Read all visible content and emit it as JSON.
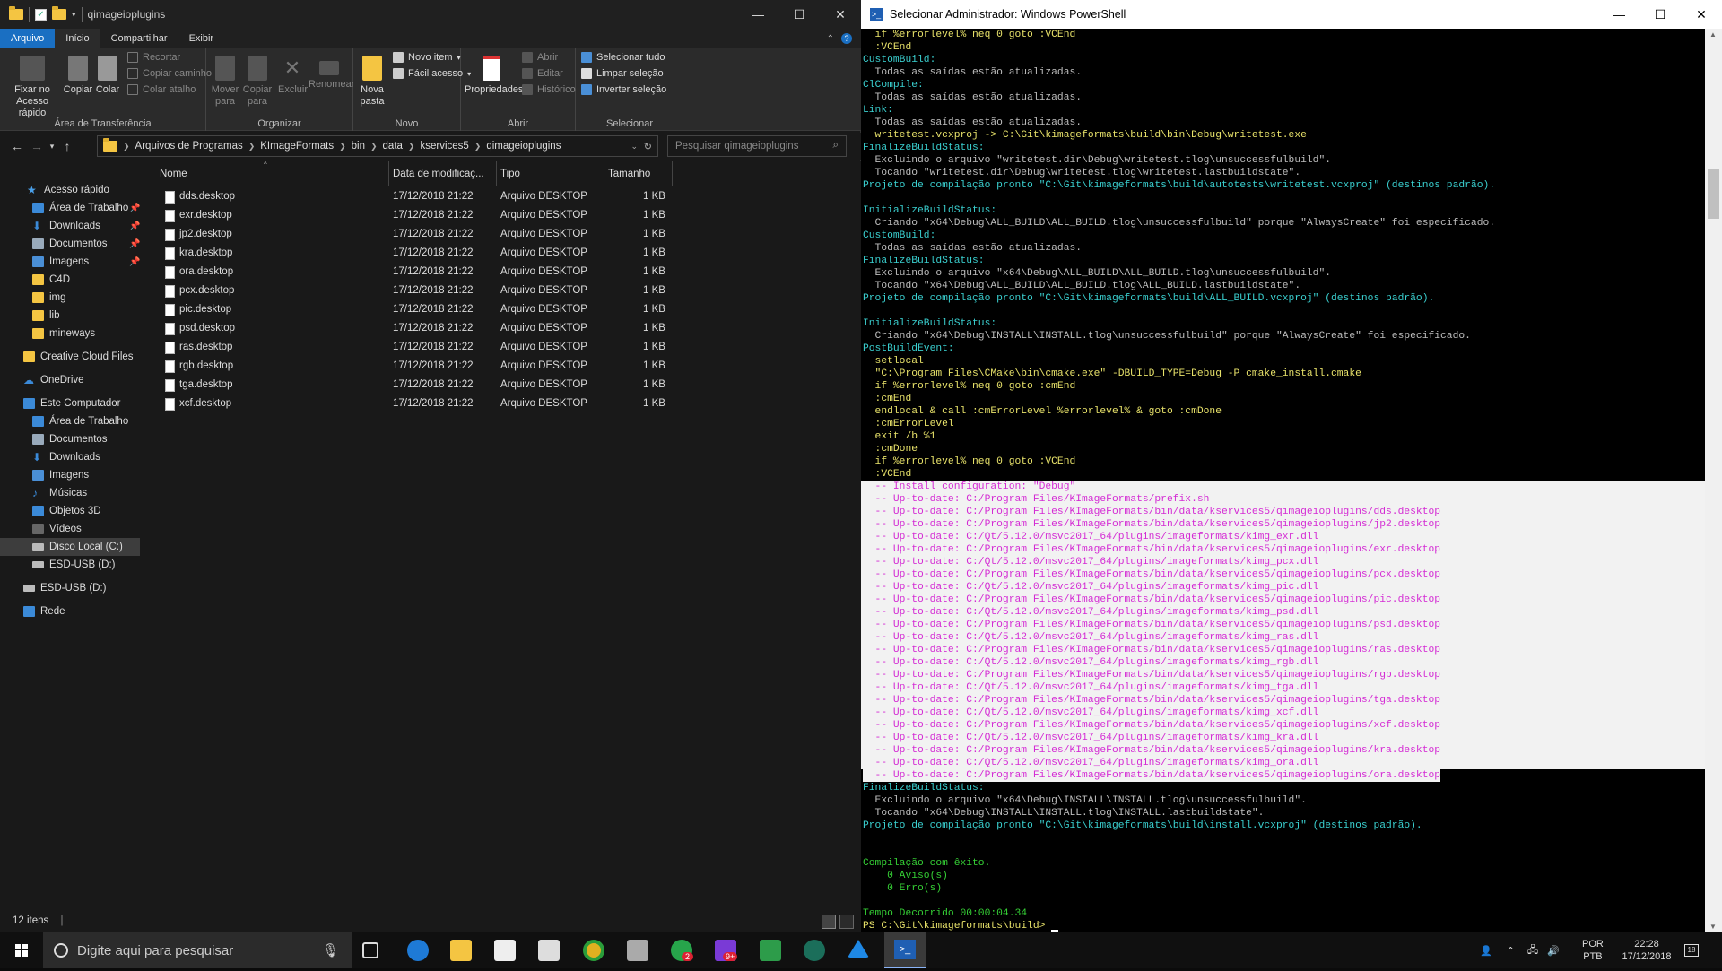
{
  "explorer": {
    "title": "qimageioplugins",
    "tabs": [
      "Arquivo",
      "Início",
      "Compartilhar",
      "Exibir"
    ],
    "ribbon": {
      "pin": "Fixar no Acesso rápido",
      "copy": "Copiar",
      "paste": "Colar",
      "cut": "Recortar",
      "copy_path": "Copiar caminho",
      "paste_shortcut": "Colar atalho",
      "group_clipboard": "Área de Transferência",
      "move_to": "Mover para",
      "copy_to": "Copiar para",
      "delete": "Excluir",
      "rename": "Renomear",
      "group_organize": "Organizar",
      "new_folder": "Nova pasta",
      "new_item": "Novo item",
      "easy_access": "Fácil acesso",
      "group_new": "Novo",
      "properties": "Propriedades",
      "open": "Abrir",
      "edit": "Editar",
      "history": "Histórico",
      "group_open": "Abrir",
      "select_all": "Selecionar tudo",
      "select_none": "Limpar seleção",
      "invert": "Inverter seleção",
      "group_select": "Selecionar"
    },
    "breadcrumb": [
      "Arquivos de Programas",
      "KImageFormats",
      "bin",
      "data",
      "kservices5",
      "qimageioplugins"
    ],
    "search_placeholder": "Pesquisar qimageioplugins",
    "nav": {
      "quick_access": "Acesso rápido",
      "desktop_pin": "Área de Trabalho",
      "downloads_pin": "Downloads",
      "documents_pin": "Documentos",
      "images_pin": "Imagens",
      "c4d": "C4D",
      "img": "img",
      "lib": "lib",
      "mineways": "mineways",
      "creative_cloud": "Creative Cloud Files",
      "onedrive": "OneDrive",
      "this_pc": "Este Computador",
      "pc_desktop": "Área de Trabalho",
      "pc_documents": "Documentos",
      "pc_downloads": "Downloads",
      "pc_images": "Imagens",
      "pc_music": "Músicas",
      "pc_3d": "Objetos 3D",
      "pc_videos": "Vídeos",
      "local_disk": "Disco Local (C:)",
      "esd_usb": "ESD-USB (D:)",
      "esd_usb2": "ESD-USB (D:)",
      "network": "Rede"
    },
    "columns": {
      "name": "Nome",
      "date": "Data de modificaç...",
      "type": "Tipo",
      "size": "Tamanho"
    },
    "files": [
      {
        "name": "dds.desktop",
        "date": "17/12/2018 21:22",
        "type": "Arquivo DESKTOP",
        "size": "1 KB"
      },
      {
        "name": "exr.desktop",
        "date": "17/12/2018 21:22",
        "type": "Arquivo DESKTOP",
        "size": "1 KB"
      },
      {
        "name": "jp2.desktop",
        "date": "17/12/2018 21:22",
        "type": "Arquivo DESKTOP",
        "size": "1 KB"
      },
      {
        "name": "kra.desktop",
        "date": "17/12/2018 21:22",
        "type": "Arquivo DESKTOP",
        "size": "1 KB"
      },
      {
        "name": "ora.desktop",
        "date": "17/12/2018 21:22",
        "type": "Arquivo DESKTOP",
        "size": "1 KB"
      },
      {
        "name": "pcx.desktop",
        "date": "17/12/2018 21:22",
        "type": "Arquivo DESKTOP",
        "size": "1 KB"
      },
      {
        "name": "pic.desktop",
        "date": "17/12/2018 21:22",
        "type": "Arquivo DESKTOP",
        "size": "1 KB"
      },
      {
        "name": "psd.desktop",
        "date": "17/12/2018 21:22",
        "type": "Arquivo DESKTOP",
        "size": "1 KB"
      },
      {
        "name": "ras.desktop",
        "date": "17/12/2018 21:22",
        "type": "Arquivo DESKTOP",
        "size": "1 KB"
      },
      {
        "name": "rgb.desktop",
        "date": "17/12/2018 21:22",
        "type": "Arquivo DESKTOP",
        "size": "1 KB"
      },
      {
        "name": "tga.desktop",
        "date": "17/12/2018 21:22",
        "type": "Arquivo DESKTOP",
        "size": "1 KB"
      },
      {
        "name": "xcf.desktop",
        "date": "17/12/2018 21:22",
        "type": "Arquivo DESKTOP",
        "size": "1 KB"
      }
    ],
    "status": "12 itens"
  },
  "powershell": {
    "title": "Selecionar Administrador: Windows PowerShell",
    "lines": [
      {
        "t": "  if %errorlevel% neq 0 goto :VCEnd",
        "c": "y"
      },
      {
        "t": "  :VCEnd",
        "c": "y"
      },
      {
        "t": "CustomBuild:",
        "c": "c"
      },
      {
        "t": "  Todas as saídas estão atualizadas.",
        "c": "w"
      },
      {
        "t": "ClCompile:",
        "c": "c"
      },
      {
        "t": "  Todas as saídas estão atualizadas.",
        "c": "w"
      },
      {
        "t": "Link:",
        "c": "c"
      },
      {
        "t": "  Todas as saídas estão atualizadas.",
        "c": "w"
      },
      {
        "t": "  writetest.vcxproj -> C:\\Git\\kimageformats\\build\\bin\\Debug\\writetest.exe",
        "c": "y"
      },
      {
        "t": "FinalizeBuildStatus:",
        "c": "c"
      },
      {
        "t": "  Excluindo o arquivo \"writetest.dir\\Debug\\writetest.tlog\\unsuccessfulbuild\".",
        "c": "w"
      },
      {
        "t": "  Tocando \"writetest.dir\\Debug\\writetest.tlog\\writetest.lastbuildstate\".",
        "c": "w"
      },
      {
        "t": "Projeto de compilação pronto \"C:\\Git\\kimageformats\\build\\autotests\\writetest.vcxproj\" (destinos padrão).",
        "c": "c"
      },
      {
        "t": "",
        "c": "w"
      },
      {
        "t": "InitializeBuildStatus:",
        "c": "c"
      },
      {
        "t": "  Criando \"x64\\Debug\\ALL_BUILD\\ALL_BUILD.tlog\\unsuccessfulbuild\" porque \"AlwaysCreate\" foi especificado.",
        "c": "w"
      },
      {
        "t": "CustomBuild:",
        "c": "c"
      },
      {
        "t": "  Todas as saídas estão atualizadas.",
        "c": "w"
      },
      {
        "t": "FinalizeBuildStatus:",
        "c": "c"
      },
      {
        "t": "  Excluindo o arquivo \"x64\\Debug\\ALL_BUILD\\ALL_BUILD.tlog\\unsuccessfulbuild\".",
        "c": "w"
      },
      {
        "t": "  Tocando \"x64\\Debug\\ALL_BUILD\\ALL_BUILD.tlog\\ALL_BUILD.lastbuildstate\".",
        "c": "w"
      },
      {
        "t": "Projeto de compilação pronto \"C:\\Git\\kimageformats\\build\\ALL_BUILD.vcxproj\" (destinos padrão).",
        "c": "c"
      },
      {
        "t": "",
        "c": "w"
      },
      {
        "t": "InitializeBuildStatus:",
        "c": "c"
      },
      {
        "t": "  Criando \"x64\\Debug\\INSTALL\\INSTALL.tlog\\unsuccessfulbuild\" porque \"AlwaysCreate\" foi especificado.",
        "c": "w"
      },
      {
        "t": "PostBuildEvent:",
        "c": "c"
      },
      {
        "t": "  setlocal",
        "c": "y"
      },
      {
        "t": "  \"C:\\Program Files\\CMake\\bin\\cmake.exe\" -DBUILD_TYPE=Debug -P cmake_install.cmake",
        "c": "y"
      },
      {
        "t": "  if %errorlevel% neq 0 goto :cmEnd",
        "c": "y"
      },
      {
        "t": "  :cmEnd",
        "c": "y"
      },
      {
        "t": "  endlocal & call :cmErrorLevel %errorlevel% & goto :cmDone",
        "c": "y"
      },
      {
        "t": "  :cmErrorLevel",
        "c": "y"
      },
      {
        "t": "  exit /b %1",
        "c": "y"
      },
      {
        "t": "  :cmDone",
        "c": "y"
      },
      {
        "t": "  if %errorlevel% neq 0 goto :VCEnd",
        "c": "y"
      },
      {
        "t": "  :VCEnd",
        "c": "y"
      },
      {
        "t": "  -- Install configuration: \"Debug\"",
        "c": "m",
        "hl": 1
      },
      {
        "t": "  -- Up-to-date: C:/Program Files/KImageFormats/prefix.sh",
        "c": "m",
        "hl": 1
      },
      {
        "t": "  -- Up-to-date: C:/Program Files/KImageFormats/bin/data/kservices5/qimageioplugins/dds.desktop",
        "c": "m",
        "hl": 1
      },
      {
        "t": "  -- Up-to-date: C:/Program Files/KImageFormats/bin/data/kservices5/qimageioplugins/jp2.desktop",
        "c": "m",
        "hl": 1
      },
      {
        "t": "  -- Up-to-date: C:/Qt/5.12.0/msvc2017_64/plugins/imageformats/kimg_exr.dll",
        "c": "m",
        "hl": 1
      },
      {
        "t": "  -- Up-to-date: C:/Program Files/KImageFormats/bin/data/kservices5/qimageioplugins/exr.desktop",
        "c": "m",
        "hl": 1
      },
      {
        "t": "  -- Up-to-date: C:/Qt/5.12.0/msvc2017_64/plugins/imageformats/kimg_pcx.dll",
        "c": "m",
        "hl": 1
      },
      {
        "t": "  -- Up-to-date: C:/Program Files/KImageFormats/bin/data/kservices5/qimageioplugins/pcx.desktop",
        "c": "m",
        "hl": 1
      },
      {
        "t": "  -- Up-to-date: C:/Qt/5.12.0/msvc2017_64/plugins/imageformats/kimg_pic.dll",
        "c": "m",
        "hl": 1
      },
      {
        "t": "  -- Up-to-date: C:/Program Files/KImageFormats/bin/data/kservices5/qimageioplugins/pic.desktop",
        "c": "m",
        "hl": 1
      },
      {
        "t": "  -- Up-to-date: C:/Qt/5.12.0/msvc2017_64/plugins/imageformats/kimg_psd.dll",
        "c": "m",
        "hl": 1
      },
      {
        "t": "  -- Up-to-date: C:/Program Files/KImageFormats/bin/data/kservices5/qimageioplugins/psd.desktop",
        "c": "m",
        "hl": 1
      },
      {
        "t": "  -- Up-to-date: C:/Qt/5.12.0/msvc2017_64/plugins/imageformats/kimg_ras.dll",
        "c": "m",
        "hl": 1
      },
      {
        "t": "  -- Up-to-date: C:/Program Files/KImageFormats/bin/data/kservices5/qimageioplugins/ras.desktop",
        "c": "m",
        "hl": 1
      },
      {
        "t": "  -- Up-to-date: C:/Qt/5.12.0/msvc2017_64/plugins/imageformats/kimg_rgb.dll",
        "c": "m",
        "hl": 1
      },
      {
        "t": "  -- Up-to-date: C:/Program Files/KImageFormats/bin/data/kservices5/qimageioplugins/rgb.desktop",
        "c": "m",
        "hl": 1
      },
      {
        "t": "  -- Up-to-date: C:/Qt/5.12.0/msvc2017_64/plugins/imageformats/kimg_tga.dll",
        "c": "m",
        "hl": 1
      },
      {
        "t": "  -- Up-to-date: C:/Program Files/KImageFormats/bin/data/kservices5/qimageioplugins/tga.desktop",
        "c": "m",
        "hl": 1
      },
      {
        "t": "  -- Up-to-date: C:/Qt/5.12.0/msvc2017_64/plugins/imageformats/kimg_xcf.dll",
        "c": "m",
        "hl": 1
      },
      {
        "t": "  -- Up-to-date: C:/Program Files/KImageFormats/bin/data/kservices5/qimageioplugins/xcf.desktop",
        "c": "m",
        "hl": 1
      },
      {
        "t": "  -- Up-to-date: C:/Qt/5.12.0/msvc2017_64/plugins/imageformats/kimg_kra.dll",
        "c": "m",
        "hl": 1
      },
      {
        "t": "  -- Up-to-date: C:/Program Files/KImageFormats/bin/data/kservices5/qimageioplugins/kra.desktop",
        "c": "m",
        "hl": 1
      },
      {
        "t": "  -- Up-to-date: C:/Qt/5.12.0/msvc2017_64/plugins/imageformats/kimg_ora.dll",
        "c": "m",
        "hl": 1
      },
      {
        "t": "  -- Up-to-date: C:/Program Files/KImageFormats/bin/data/kservices5/qimageioplugins/ora.desktop",
        "c": "m",
        "hl": 2
      },
      {
        "t": "FinalizeBuildStatus:",
        "c": "c"
      },
      {
        "t": "  Excluindo o arquivo \"x64\\Debug\\INSTALL\\INSTALL.tlog\\unsuccessfulbuild\".",
        "c": "w"
      },
      {
        "t": "  Tocando \"x64\\Debug\\INSTALL\\INSTALL.tlog\\INSTALL.lastbuildstate\".",
        "c": "w"
      },
      {
        "t": "Projeto de compilação pronto \"C:\\Git\\kimageformats\\build\\install.vcxproj\" (destinos padrão).",
        "c": "c"
      },
      {
        "t": "",
        "c": "w"
      },
      {
        "t": "",
        "c": "w"
      },
      {
        "t": "Compilação com êxito.",
        "c": "g"
      },
      {
        "t": "    0 Aviso(s)",
        "c": "g"
      },
      {
        "t": "    0 Erro(s)",
        "c": "g"
      },
      {
        "t": "",
        "c": "w"
      },
      {
        "t": "Tempo Decorrido 00:00:04.34",
        "c": "g"
      },
      {
        "t": "PS C:\\Git\\kimageformats\\build> ",
        "c": "y",
        "cursor": 1
      }
    ]
  },
  "taskbar": {
    "search_placeholder": "Digite aqui para pesquisar",
    "lang": "POR",
    "layout": "PTB",
    "time": "22:28",
    "date": "17/12/2018",
    "notif_count": "18",
    "badge_whatsapp": "2",
    "badge_other": "9+"
  }
}
